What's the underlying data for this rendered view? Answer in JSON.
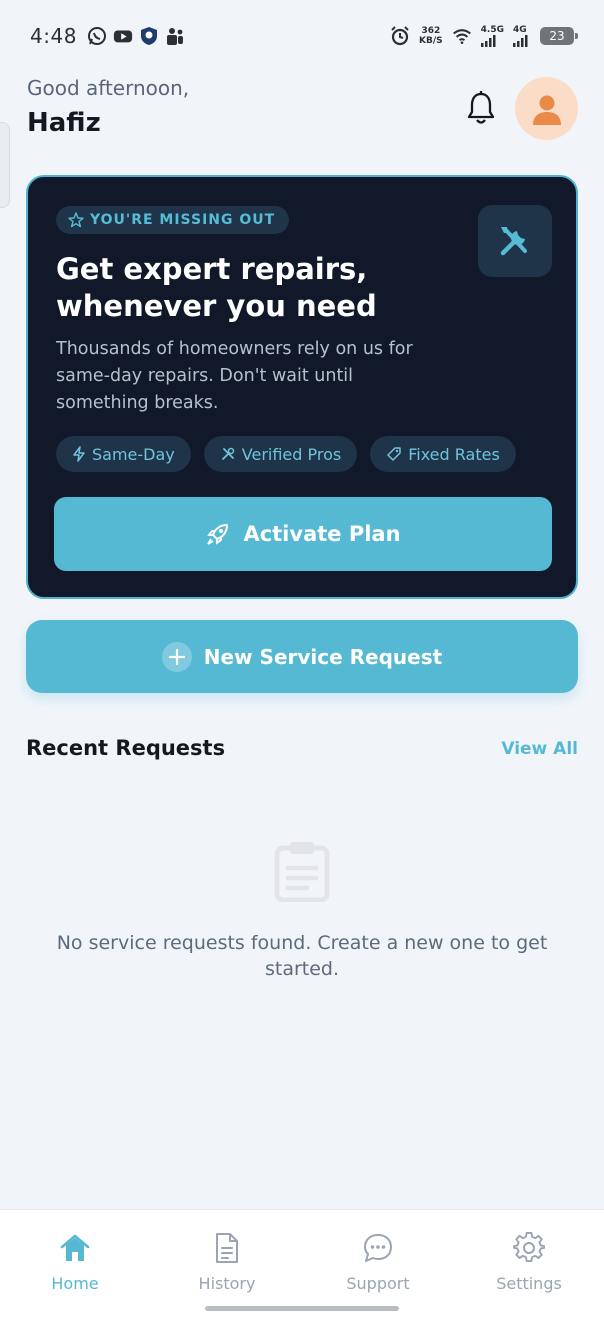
{
  "status_bar": {
    "time": "4:48",
    "speed_value": "362",
    "speed_unit": "KB/S",
    "net1": "4.5G",
    "net2": "4G",
    "battery": "23"
  },
  "header": {
    "greeting": "Good afternoon,",
    "user_name": "Hafiz",
    "icons": {
      "notifications": "bell-icon",
      "avatar": "user-avatar-icon"
    }
  },
  "promo": {
    "badge": "YOU'RE MISSING OUT",
    "title": "Get expert repairs, whenever you need",
    "description": "Thousands of homeowners rely on us for same-day repairs. Don't wait until something breaks.",
    "chips": [
      "Same-Day",
      "Verified Pros",
      "Fixed Rates"
    ],
    "cta": "Activate Plan",
    "accent_color": "#56b9d4",
    "card_color": "#111829"
  },
  "new_request": {
    "label": "New Service Request"
  },
  "recent": {
    "title": "Recent Requests",
    "view_all": "View All",
    "empty_message": "No service requests found. Create a new one to get started."
  },
  "bottom_nav": {
    "items": [
      {
        "label": "Home",
        "icon": "home-icon",
        "active": true
      },
      {
        "label": "History",
        "icon": "document-icon",
        "active": false
      },
      {
        "label": "Support",
        "icon": "chat-icon",
        "active": false
      },
      {
        "label": "Settings",
        "icon": "gear-icon",
        "active": false
      }
    ]
  }
}
